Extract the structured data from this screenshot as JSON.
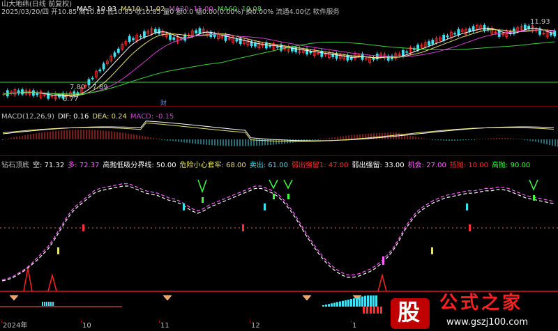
{
  "window": {
    "title": "山大地纬(日线 前复权)"
  },
  "price_panel": {
    "ma_legend": [
      {
        "label": "MA5: 10.93",
        "color": "#ffffff"
      },
      {
        "label": "MA10: 11.02",
        "color": "#e8e070"
      },
      {
        "label": "MA20: 11.00",
        "color": "#d040d0"
      },
      {
        "label": "MA60: 10.08",
        "color": "#40d040"
      }
    ],
    "info_line": "2025/03/20/四 开10.85 高10.85 低10.85 收10.85 量0 额0.0 幅0.00(0.00%) 换0.00% 流通4.00亿 软件服务",
    "labels": {
      "high_mark": "11.93",
      "low_mark": "6.77",
      "mid_mark": "7.80 - 7.89",
      "cai": "财"
    },
    "colors": {
      "up": "#ff3030",
      "down": "#40e0f0",
      "ma5": "#ffffff",
      "ma10": "#e8e070",
      "ma20": "#d040d0",
      "ma60": "#40d040"
    }
  },
  "macd_panel": {
    "legend": [
      {
        "label": "MACD(12,26,9)",
        "color": "#c0c0c0"
      },
      {
        "label": "DIF: 0.16",
        "color": "#ffffff"
      },
      {
        "label": "DEA: 0.24",
        "color": "#e8e070"
      },
      {
        "label": "MACD: -0.15",
        "color": "#d040d0"
      }
    ]
  },
  "indicator_panel": {
    "legend": [
      {
        "label": "钻石顶底",
        "color": "#c0c0c0"
      },
      {
        "label": "空: 71.32",
        "color": "#ffffff"
      },
      {
        "label": "多: 72.37",
        "color": "#ff60ff"
      },
      {
        "label": "高抛低吸分界线: 50.00",
        "color": "#ffffff"
      },
      {
        "label": "危险小心套牢: 68.00",
        "color": "#e8e070"
      },
      {
        "label": "卖出: 61.00",
        "color": "#40e0f0"
      },
      {
        "label": "弱出强留1: 47.00",
        "color": "#ff3030"
      },
      {
        "label": "弱出强留: 33.00",
        "color": "#ffffff"
      },
      {
        "label": "机会: 27.00",
        "color": "#ff60ff"
      },
      {
        "label": "抵抛: 10.00",
        "color": "#ff3030"
      },
      {
        "label": "高抛: 90.00",
        "color": "#40ff40"
      }
    ]
  },
  "x_axis": {
    "labels": [
      "2024年",
      "10",
      "11",
      "12",
      "1"
    ]
  },
  "watermark": {
    "text": "公式之家",
    "url": "www.gszj100.com",
    "logo": "股"
  },
  "chart_data": {
    "type": "line",
    "series": [
      {
        "name": "空",
        "values": [
          10,
          11,
          13,
          16,
          19,
          23,
          27,
          32,
          37,
          44,
          52,
          60,
          67,
          72,
          76,
          80,
          84,
          86,
          87,
          88,
          89,
          90,
          90,
          88,
          86,
          84,
          83,
          82,
          80,
          78,
          77,
          75,
          72,
          69,
          67,
          69,
          72,
          74,
          76,
          78,
          80,
          82,
          84,
          86,
          88,
          88,
          86,
          84,
          81,
          76,
          70,
          63,
          55,
          47,
          40,
          33,
          27,
          22,
          18,
          15,
          13,
          13,
          14,
          16,
          18,
          21,
          25,
          30,
          36,
          44,
          53,
          60,
          66,
          70,
          73,
          76,
          78,
          80,
          81,
          82,
          83,
          84,
          84,
          85,
          86,
          86,
          87,
          87,
          86,
          84,
          82,
          80,
          79,
          78,
          77,
          76,
          75
        ]
      },
      {
        "name": "多",
        "values": [
          11,
          12,
          14,
          17,
          20,
          24,
          29,
          34,
          39,
          46,
          54,
          62,
          69,
          74,
          78,
          82,
          86,
          88,
          89,
          90,
          91,
          92,
          92,
          90,
          88,
          86,
          85,
          84,
          82,
          80,
          79,
          77,
          74,
          71,
          69,
          71,
          74,
          76,
          78,
          80,
          82,
          84,
          86,
          88,
          90,
          90,
          88,
          86,
          83,
          78,
          72,
          65,
          57,
          49,
          42,
          35,
          29,
          24,
          20,
          17,
          15,
          15,
          16,
          18,
          20,
          23,
          27,
          32,
          38,
          46,
          55,
          62,
          68,
          72,
          75,
          78,
          80,
          82,
          83,
          84,
          85,
          86,
          86,
          87,
          88,
          88,
          89,
          89,
          88,
          86,
          84,
          82,
          81,
          80,
          79,
          78,
          77
        ]
      }
    ],
    "ylim": [
      0,
      100
    ],
    "reference_lines": [
      50,
      90
    ],
    "price_ylim": [
      6.5,
      12.3
    ]
  }
}
